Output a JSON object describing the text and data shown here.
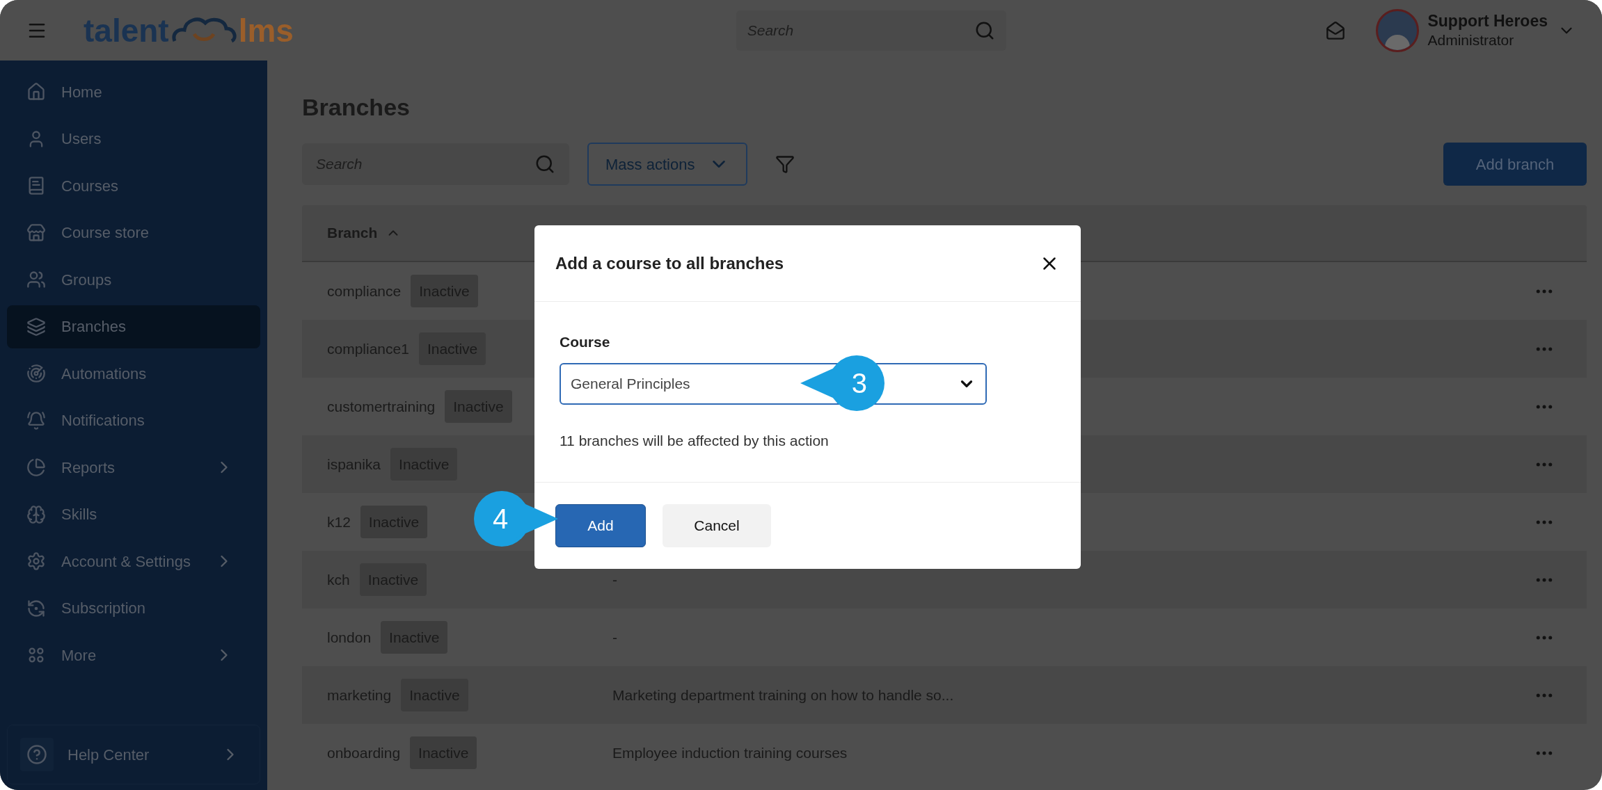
{
  "top_bar": {
    "logo": {
      "part_1": "talent",
      "part_2": "lms"
    },
    "search_placeholder": "Search",
    "user": {
      "name": "Support Heroes",
      "role": "Administrator"
    }
  },
  "sidebar": {
    "items": [
      {
        "label": "Home",
        "selected": false,
        "expandable": false
      },
      {
        "label": "Users",
        "selected": false,
        "expandable": false
      },
      {
        "label": "Courses",
        "selected": false,
        "expandable": false
      },
      {
        "label": "Course store",
        "selected": false,
        "expandable": false
      },
      {
        "label": "Groups",
        "selected": false,
        "expandable": false
      },
      {
        "label": "Branches",
        "selected": true,
        "expandable": false
      },
      {
        "label": "Automations",
        "selected": false,
        "expandable": false
      },
      {
        "label": "Notifications",
        "selected": false,
        "expandable": false
      },
      {
        "label": "Reports",
        "selected": false,
        "expandable": true
      },
      {
        "label": "Skills",
        "selected": false,
        "expandable": false
      },
      {
        "label": "Account & Settings",
        "selected": false,
        "expandable": true
      },
      {
        "label": "Subscription",
        "selected": false,
        "expandable": false
      },
      {
        "label": "More",
        "selected": false,
        "expandable": true
      }
    ],
    "help": {
      "label": "Help Center"
    }
  },
  "page": {
    "title": "Branches",
    "search": {
      "placeholder": "Search"
    },
    "mass_actions": "Mass actions",
    "add_button": "Add branch",
    "table": {
      "columns": [
        {
          "label": "Branch",
          "sorted": true
        }
      ],
      "rows": [
        {
          "name": "compliance",
          "status": "Inactive"
        },
        {
          "name": "compliance1",
          "status": "Inactive"
        },
        {
          "name": "customertraining",
          "status": "Inactive"
        },
        {
          "name": "ispanika",
          "status": "Inactive"
        },
        {
          "name": "k12",
          "status": "Inactive"
        },
        {
          "name": "kch",
          "status": "Inactive",
          "description": "-"
        },
        {
          "name": "london",
          "status": "Inactive",
          "description": "-"
        },
        {
          "name": "marketing",
          "status": "Inactive",
          "description": "Marketing department training on how to handle so..."
        },
        {
          "name": "onboarding",
          "status": "Inactive",
          "description": "Employee induction training courses"
        }
      ]
    }
  },
  "dialog": {
    "title": "Add a course to all branches",
    "field_label": "Course",
    "value": "General Principles",
    "note": "11 branches will be affected by this action",
    "buttons": [
      {
        "label": "Add",
        "kind": "primary"
      },
      {
        "label": "Cancel",
        "kind": "secondary"
      }
    ]
  },
  "callouts": [
    {
      "number": "3",
      "kind": "left"
    },
    {
      "number": "4",
      "kind": "right"
    }
  ]
}
